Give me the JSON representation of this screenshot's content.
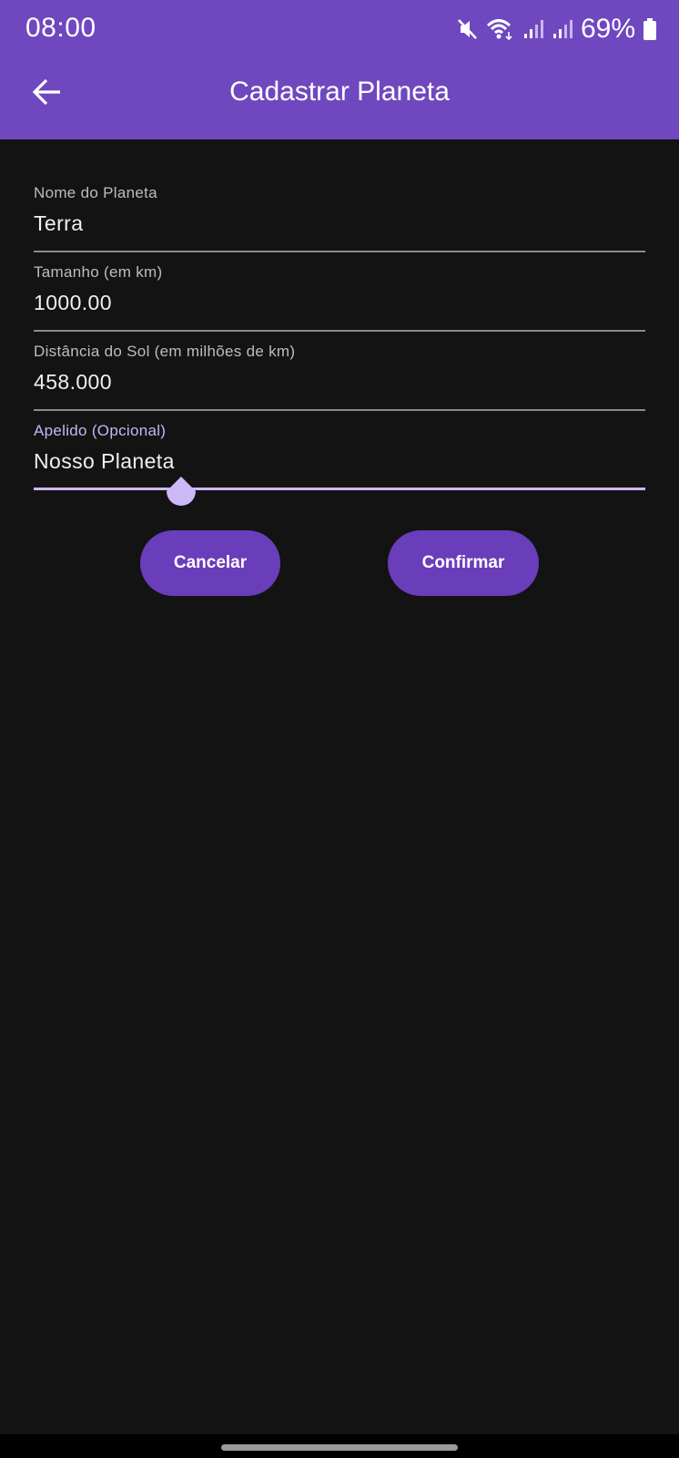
{
  "status_bar": {
    "time": "08:00",
    "battery_percent": "69%",
    "icons": [
      "mute-icon",
      "wifi-icon",
      "signal-icon",
      "signal-icon",
      "battery-icon"
    ]
  },
  "app_bar": {
    "title": "Cadastrar Planeta",
    "back_icon": "arrow-back-icon",
    "color": "#6f48bf"
  },
  "form": {
    "fields": [
      {
        "label": "Nome do Planeta",
        "value": "Terra"
      },
      {
        "label": "Tamanho (em km)",
        "value": "1000.00"
      },
      {
        "label": "Distância do Sol (em milhões de km)",
        "value": "458.000"
      },
      {
        "label": "Apelido (Opcional)",
        "value": "Nosso Planeta",
        "focused": true
      }
    ]
  },
  "actions": {
    "cancel_label": "Cancelar",
    "confirm_label": "Confirmar",
    "button_color": "#6a3dbb"
  },
  "theme": {
    "background": "#131313",
    "accent": "#cdb8f8"
  }
}
